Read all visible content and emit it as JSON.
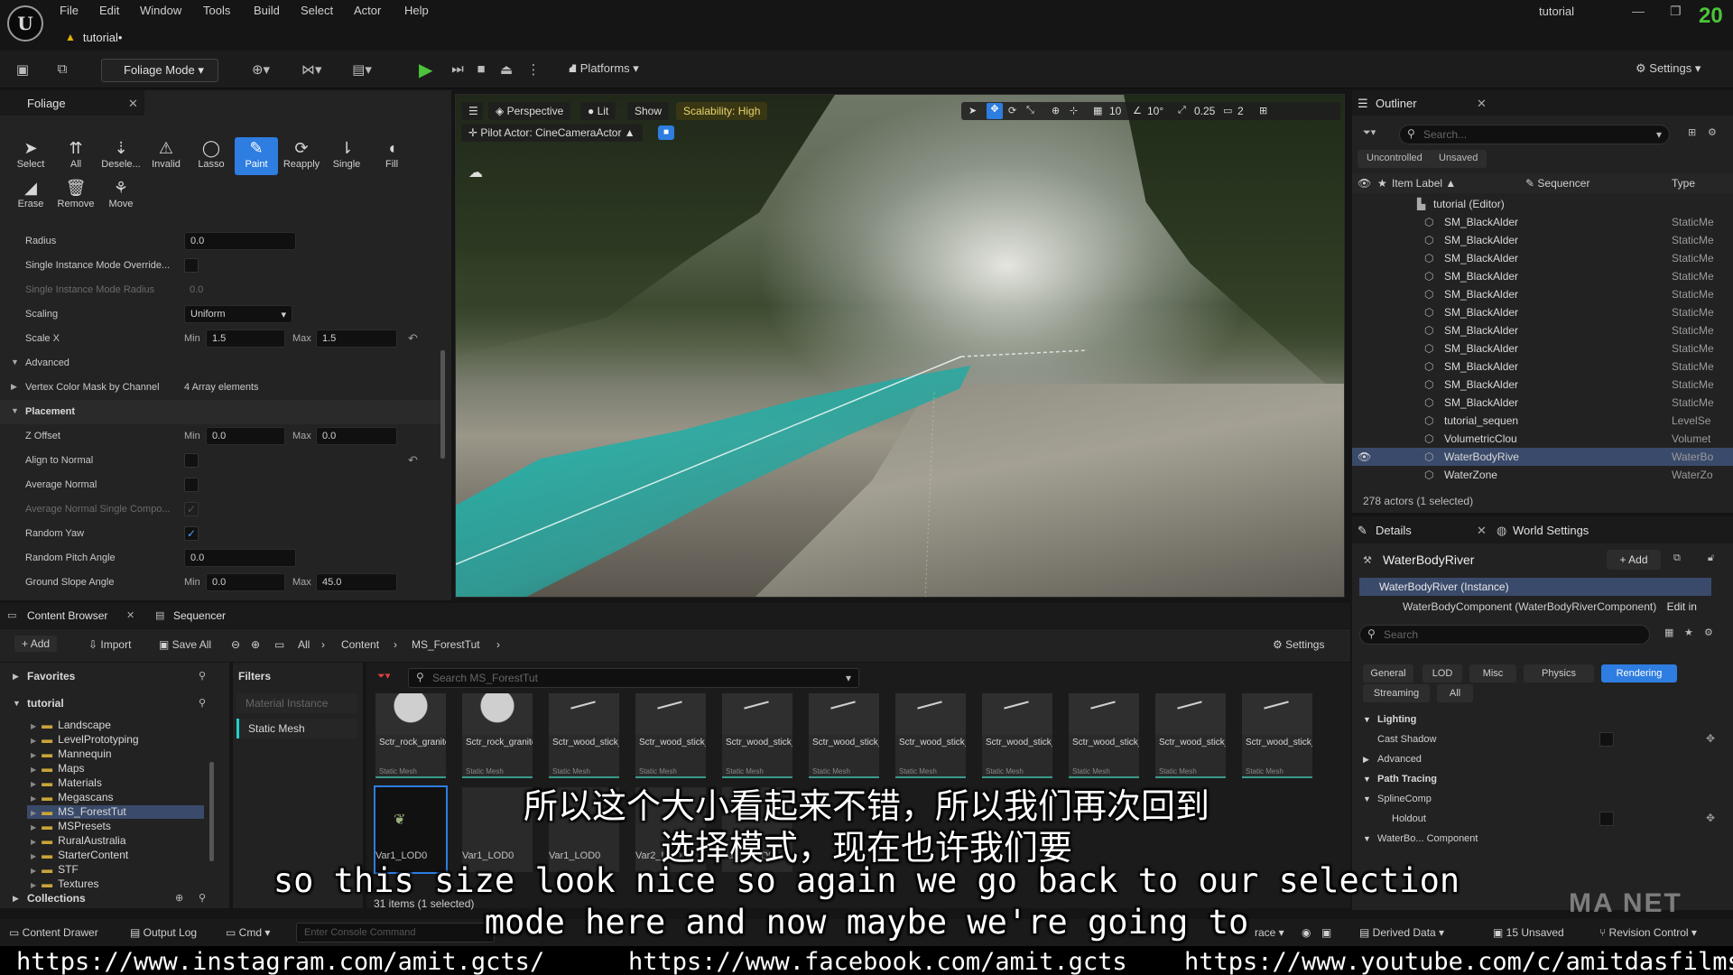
{
  "menu": {
    "logo": "U",
    "items": [
      "File",
      "Edit",
      "Window",
      "Tools",
      "Build",
      "Select",
      "Actor",
      "Help"
    ],
    "app_title": "tutorial",
    "channel_number": "20",
    "level_tab": "tutorial•"
  },
  "toolbar": {
    "mode": "Foliage Mode",
    "platforms": "Platforms",
    "settings": "Settings"
  },
  "foliage": {
    "tab": "Foliage",
    "tools_row1": [
      "Select",
      "All",
      "Deselect",
      "Invalid",
      "Lasso",
      "Paint",
      "Reapply",
      "Single",
      "Fill"
    ],
    "tools_row1_display": [
      "Select",
      "All",
      "Desele...",
      "Invalid",
      "Lasso",
      "Paint",
      "Reapply",
      "Single",
      "Fill"
    ],
    "tools_row2": [
      "Erase",
      "Remove",
      "Move"
    ],
    "active_tool": "Paint",
    "props": {
      "radius_label": "Radius",
      "radius_value": "0.0",
      "single_override_label": "Single Instance Mode Override...",
      "single_radius_label": "Single Instance Mode Radius",
      "single_radius_value": "0.0",
      "scaling_label": "Scaling",
      "scaling_value": "Uniform",
      "scalex_label": "Scale X",
      "scalex_min": "1.5",
      "scalex_max": "1.5",
      "advanced_label": "Advanced",
      "vertex_label": "Vertex Color Mask by Channel",
      "vertex_value": "4 Array elements",
      "placement_label": "Placement",
      "zoffset_label": "Z Offset",
      "zoffset_min": "0.0",
      "zoffset_max": "0.0",
      "align_label": "Align to Normal",
      "avgnormal_label": "Average Normal",
      "avgnormal_single_label": "Average Normal Single Compo...",
      "randomyaw_label": "Random Yaw",
      "randompitch_label": "Random Pitch Angle",
      "randompitch_value": "0.0",
      "groundslope_label": "Ground Slope Angle",
      "groundslope_min": "0.0",
      "groundslope_max": "45.0",
      "min": "Min",
      "max": "Max"
    }
  },
  "viewport": {
    "perspective": "Perspective",
    "lit": "Lit",
    "show": "Show",
    "scalability": "Scalability: High",
    "pilot": "Pilot Actor: CineCameraActor",
    "grid": "10",
    "angle": "10°",
    "scale": "0.25",
    "cam_speed": "2"
  },
  "outliner": {
    "tab": "Outliner",
    "search_placeholder": "Search...",
    "filter_uncontrolled": "Uncontrolled",
    "filter_unsaved": "Unsaved",
    "col_label": "Item Label",
    "col_sequencer": "Sequencer",
    "col_type": "Type",
    "root": "tutorial (Editor)",
    "rows": [
      {
        "name": "SM_BlackAlder",
        "type": "StaticMe"
      },
      {
        "name": "SM_BlackAlder",
        "type": "StaticMe"
      },
      {
        "name": "SM_BlackAlder",
        "type": "StaticMe"
      },
      {
        "name": "SM_BlackAlder",
        "type": "StaticMe"
      },
      {
        "name": "SM_BlackAlder",
        "type": "StaticMe"
      },
      {
        "name": "SM_BlackAlder",
        "type": "StaticMe"
      },
      {
        "name": "SM_BlackAlder",
        "type": "StaticMe"
      },
      {
        "name": "SM_BlackAlder",
        "type": "StaticMe"
      },
      {
        "name": "SM_BlackAlder",
        "type": "StaticMe"
      },
      {
        "name": "SM_BlackAlder",
        "type": "StaticMe"
      },
      {
        "name": "SM_BlackAlder",
        "type": "StaticMe"
      },
      {
        "name": "tutorial_sequen",
        "type": "LevelSe"
      },
      {
        "name": "VolumetricClou",
        "type": "Volumet"
      },
      {
        "name": "WaterBodyRive",
        "type": "WaterBo"
      },
      {
        "name": "WaterZone",
        "type": "WaterZo"
      }
    ],
    "count": "278 actors (1 selected)"
  },
  "details": {
    "tab": "Details",
    "world_tab": "World Settings",
    "title": "WaterBodyRiver",
    "add": "Add",
    "instance": "WaterBodyRiver (Instance)",
    "component": "WaterBodyComponent (WaterBodyRiverComponent)",
    "edit_in": "Edit in",
    "search_placeholder": "Search",
    "cats": [
      "General",
      "LOD",
      "Misc",
      "Physics",
      "Rendering",
      "Streaming",
      "All"
    ],
    "lighting": "Lighting",
    "cast_shadow": "Cast Shadow",
    "advanced": "Advanced",
    "path_tracing": "Path Tracing",
    "spline": "SplineComp",
    "holdout": "Holdout",
    "water_body": "WaterBo... Component"
  },
  "content_browser": {
    "tab": "Content Browser",
    "tab2": "Sequencer",
    "add": "Add",
    "import": "Import",
    "save_all": "Save All",
    "crumb_all": "All",
    "crumb_content": "Content",
    "crumb_folder": "MS_ForestTut",
    "settings": "Settings",
    "favorites": "Favorites",
    "root": "tutorial",
    "folders": [
      "Landscape",
      "LevelPrototyping",
      "Mannequin",
      "Maps",
      "Materials",
      "Megascans",
      "MS_ForestTut",
      "MSPresets",
      "RuralAustralia",
      "StarterContent",
      "STF",
      "Textures"
    ],
    "collections": "Collections",
    "filters_title": "Filters",
    "filter_items": [
      "Material Instance",
      "Static Mesh"
    ],
    "search_placeholder": "Search MS_ForestTut",
    "assets": [
      {
        "name": "Sctr_rock_granite_T_",
        "kind": "Static Mesh",
        "thumb": "rock"
      },
      {
        "name": "Sctr_rock_granite_T_",
        "kind": "Static Mesh",
        "thumb": "rock"
      },
      {
        "name": "Sctr_wood_stick_M_pdye3",
        "kind": "Static Mesh",
        "thumb": "stick"
      },
      {
        "name": "Sctr_wood_stick_M_pdye3",
        "kind": "Static Mesh",
        "thumb": "stick"
      },
      {
        "name": "Sctr_wood_stick_M_pdye3",
        "kind": "Static Mesh",
        "thumb": "stick"
      },
      {
        "name": "Sctr_wood_stick_M_pdye3",
        "kind": "Static Mesh",
        "thumb": "stick"
      },
      {
        "name": "Sctr_wood_stick_M_pdye3",
        "kind": "Static Mesh",
        "thumb": "stick"
      },
      {
        "name": "Sctr_wood_stick_M_pdye3",
        "kind": "Static Mesh",
        "thumb": "stick"
      },
      {
        "name": "Sctr_wood_stick_M_pdye3",
        "kind": "Static Mesh",
        "thumb": "stick"
      },
      {
        "name": "Sctr_wood_stick_M_pdye3",
        "kind": "Static Mesh",
        "thumb": "stick"
      },
      {
        "name": "Sctr_wood_stick_M_pdye3",
        "kind": "Static Mesh",
        "thumb": "stick"
      }
    ],
    "row2_labels": [
      "Var1_LOD0",
      "Var1_LOD0",
      "Var1_LOD0",
      "Var2_LOD0",
      "Var2_LOD0"
    ],
    "count": "31 items (1 selected)"
  },
  "statusbar": {
    "drawer": "Content Drawer",
    "output": "Output Log",
    "cmd": "Cmd",
    "console_placeholder": "Enter Console Command",
    "trace": "race",
    "derived": "Derived Data",
    "unsaved": "15 Unsaved",
    "revision": "Revision Control"
  },
  "subtitles": {
    "cn1": "所以这个大小看起来不错，所以我们再次回到",
    "cn2": "选择模式，现在也许我们要",
    "en1": "so this size look nice so again we go back to our selection",
    "en2": "mode here and now maybe we're going to"
  },
  "links": {
    "instagram": "https://www.instagram.com/amit.gcts/",
    "facebook": "https://www.facebook.com/amit.gcts",
    "youtube": "https://www.youtube.com/c/amitdasfilms"
  },
  "watermark": "MA NET"
}
